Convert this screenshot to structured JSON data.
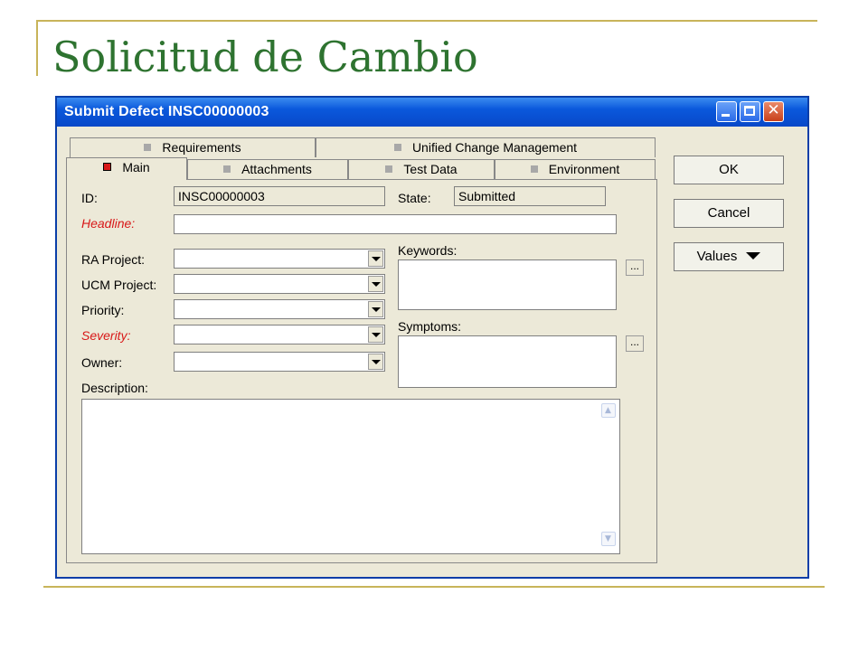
{
  "slide": {
    "title": "Solicitud de Cambio"
  },
  "window": {
    "title": "Submit Defect INSC00000003",
    "controls": {
      "minimize_icon": "minimize-icon",
      "maximize_icon": "maximize-icon",
      "close_icon": "close-icon"
    }
  },
  "tabs": {
    "row_back": [
      {
        "label": "Requirements"
      },
      {
        "label": "Unified Change Management"
      }
    ],
    "row_front": [
      {
        "label": "Main",
        "active": true
      },
      {
        "label": "Attachments"
      },
      {
        "label": "Test Data"
      },
      {
        "label": "Environment"
      }
    ]
  },
  "form": {
    "id": {
      "label": "ID:",
      "value": "INSC00000003"
    },
    "state": {
      "label": "State:",
      "value": "Submitted"
    },
    "headline": {
      "label": "Headline:",
      "value": ""
    },
    "ra_project": {
      "label": "RA Project:",
      "value": ""
    },
    "ucm_project": {
      "label": "UCM Project:",
      "value": ""
    },
    "priority": {
      "label": "Priority:",
      "value": ""
    },
    "severity": {
      "label": "Severity:",
      "value": ""
    },
    "owner": {
      "label": "Owner:",
      "value": ""
    },
    "keywords": {
      "label": "Keywords:",
      "button": "..."
    },
    "symptoms": {
      "label": "Symptoms:",
      "button": "..."
    },
    "description": {
      "label": "Description:"
    }
  },
  "buttons": {
    "ok": "OK",
    "cancel": "Cancel",
    "values": "Values"
  },
  "colors": {
    "required_label": "#d81818",
    "title_green": "#2e7330",
    "titlebar_blue": "#0a58dc"
  }
}
